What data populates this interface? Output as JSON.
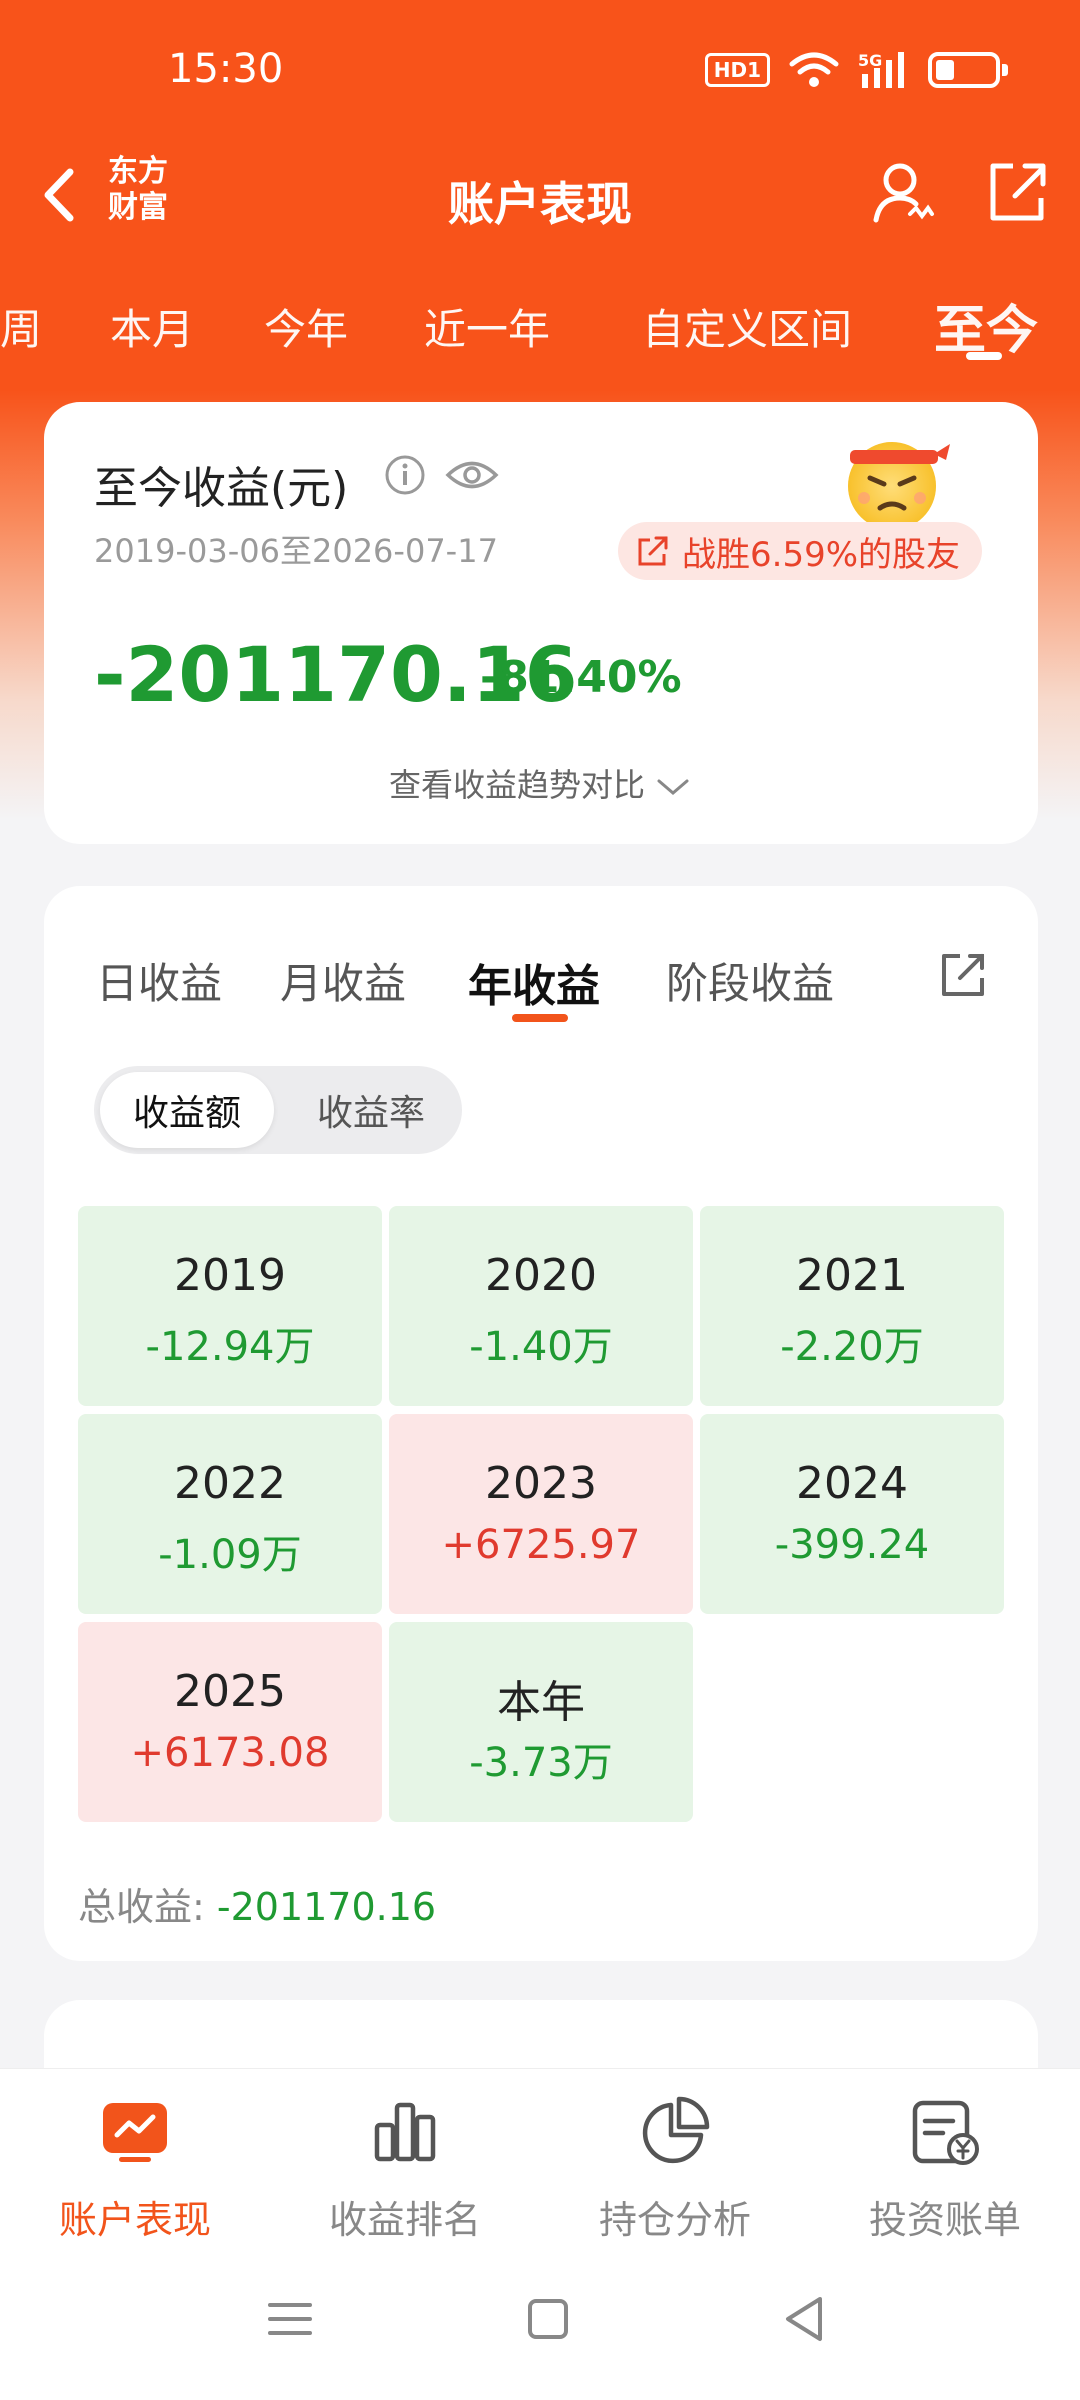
{
  "status_bar": {
    "time": "15:30",
    "hd_badge": "HD1",
    "network": "5G"
  },
  "header": {
    "brand": "东方财富",
    "title": "账户表现"
  },
  "period_tabs": [
    "周",
    "本月",
    "今年",
    "近一年",
    "自定义区间",
    "至今"
  ],
  "period_active": "至今",
  "summary": {
    "title": "至今收益(元)",
    "date_range": "2019-03-06至2026-07-17",
    "beat_text": "战胜6.59%的股友",
    "total_amount": "-201170.16",
    "total_rate": "-81.40%",
    "trend_link": "查看收益趋势对比"
  },
  "profit_tabs": [
    "日收益",
    "月收益",
    "年收益",
    "阶段收益"
  ],
  "profit_tab_active": "年收益",
  "segment": {
    "amount": "收益额",
    "rate": "收益率",
    "active": "收益额"
  },
  "yearly": [
    {
      "year": "2019",
      "value": "-12.94万",
      "sign": "neg"
    },
    {
      "year": "2020",
      "value": "-1.40万",
      "sign": "neg"
    },
    {
      "year": "2021",
      "value": "-2.20万",
      "sign": "neg"
    },
    {
      "year": "2022",
      "value": "-1.09万",
      "sign": "neg"
    },
    {
      "year": "2023",
      "value": "+6725.97",
      "sign": "pos"
    },
    {
      "year": "2024",
      "value": "-399.24",
      "sign": "neg"
    },
    {
      "year": "2025",
      "value": "+6173.08",
      "sign": "pos"
    },
    {
      "year": "本年",
      "value": "-3.73万",
      "sign": "neg"
    }
  ],
  "grand_total": {
    "label": "总收益: ",
    "value": "-201170.16"
  },
  "bottom_nav": [
    {
      "label": "账户表现",
      "icon": "chart-trend-icon",
      "active": true
    },
    {
      "label": "收益排名",
      "icon": "bar-chart-icon",
      "active": false
    },
    {
      "label": "持仓分析",
      "icon": "pie-chart-icon",
      "active": false
    },
    {
      "label": "投资账单",
      "icon": "bill-icon",
      "active": false
    }
  ],
  "colors": {
    "brand": "#f8531a",
    "loss": "#1f9a32",
    "gain": "#e03a2e"
  }
}
